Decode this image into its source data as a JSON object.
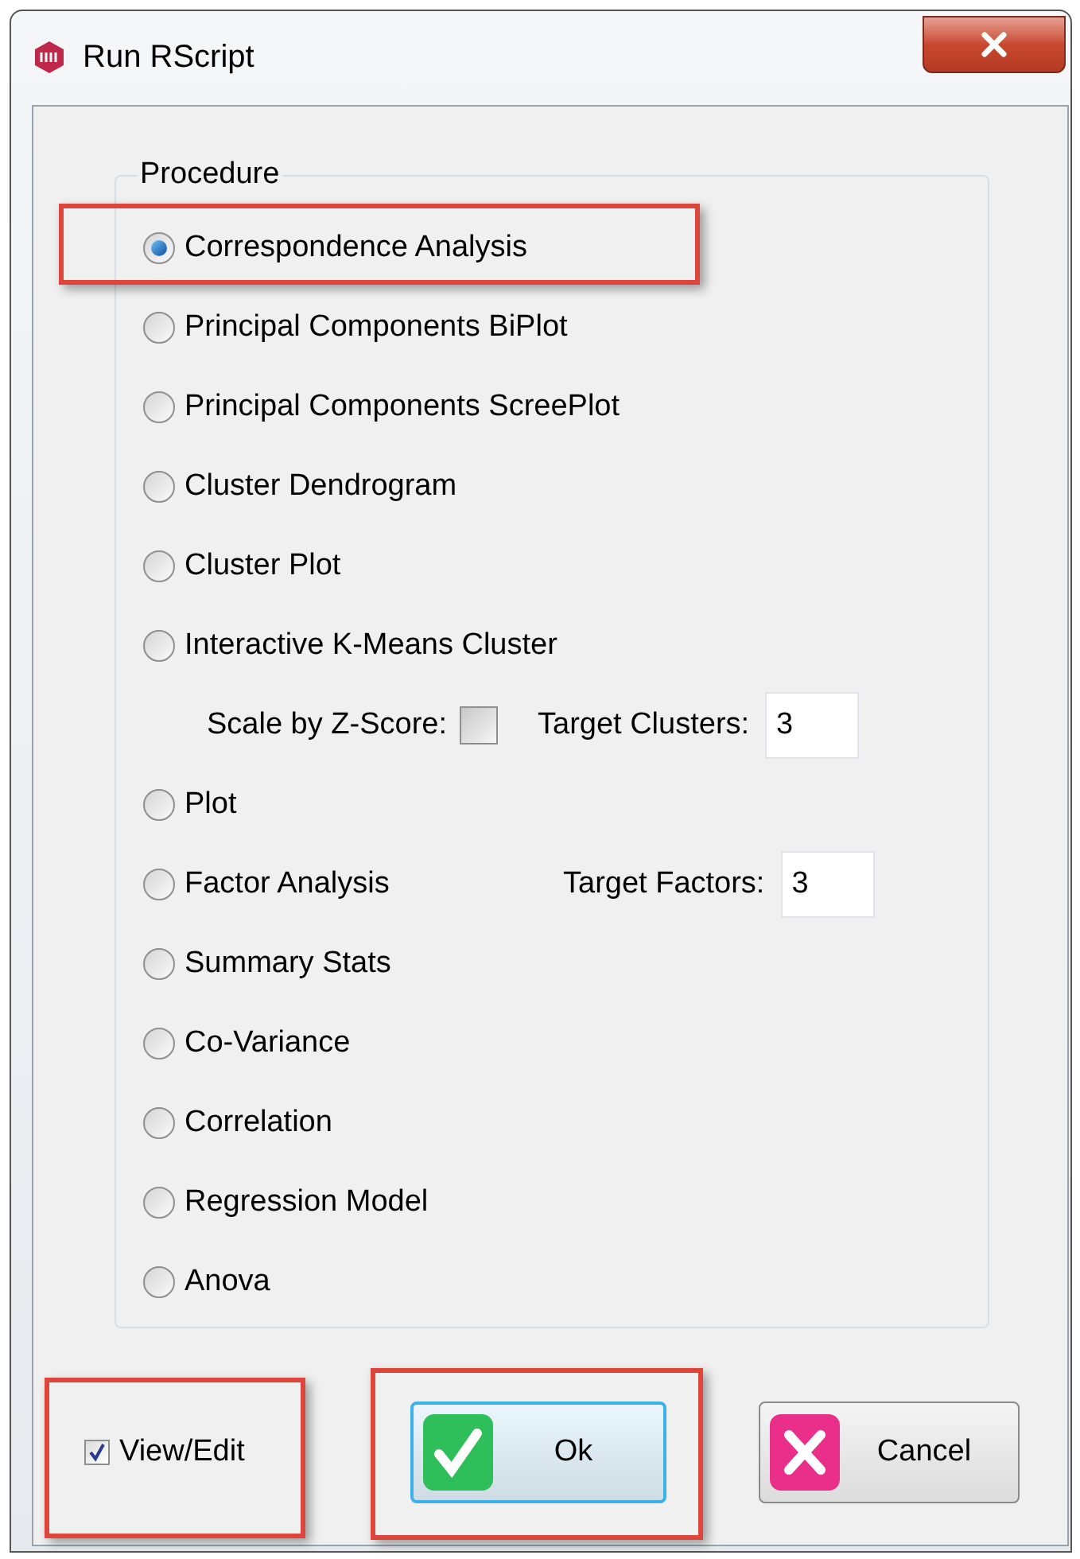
{
  "window": {
    "title": "Run RScript"
  },
  "procedure": {
    "legend": "Procedure",
    "items": [
      {
        "label": "Correspondence Analysis",
        "selected": true,
        "highlighted": true
      },
      {
        "label": "Principal Components BiPlot",
        "selected": false,
        "highlighted": false
      },
      {
        "label": "Principal Components ScreePlot",
        "selected": false,
        "highlighted": false
      },
      {
        "label": "Cluster Dendrogram",
        "selected": false,
        "highlighted": false
      },
      {
        "label": "Cluster Plot",
        "selected": false,
        "highlighted": false
      },
      {
        "label": "Interactive K-Means Cluster",
        "selected": false,
        "highlighted": false,
        "options": {
          "scale_label": "Scale by Z-Score:",
          "scale_checked": false,
          "target_label": "Target Clusters:",
          "target_value": "3"
        }
      },
      {
        "label": "Plot",
        "selected": false,
        "highlighted": false
      },
      {
        "label": "Factor Analysis",
        "selected": false,
        "highlighted": false,
        "target": {
          "label": "Target Factors:",
          "value": "3"
        }
      },
      {
        "label": "Summary Stats",
        "selected": false,
        "highlighted": false
      },
      {
        "label": "Co-Variance",
        "selected": false,
        "highlighted": false
      },
      {
        "label": "Correlation",
        "selected": false,
        "highlighted": false
      },
      {
        "label": "Regression Model",
        "selected": false,
        "highlighted": false
      },
      {
        "label": "Anova",
        "selected": false,
        "highlighted": false
      }
    ]
  },
  "view_edit": {
    "label": "View/Edit",
    "checked": true,
    "highlighted": true
  },
  "buttons": [
    {
      "label": "Ok",
      "kind": "ok",
      "highlighted": true
    },
    {
      "label": "Cancel",
      "kind": "cancel",
      "highlighted": false
    }
  ]
}
